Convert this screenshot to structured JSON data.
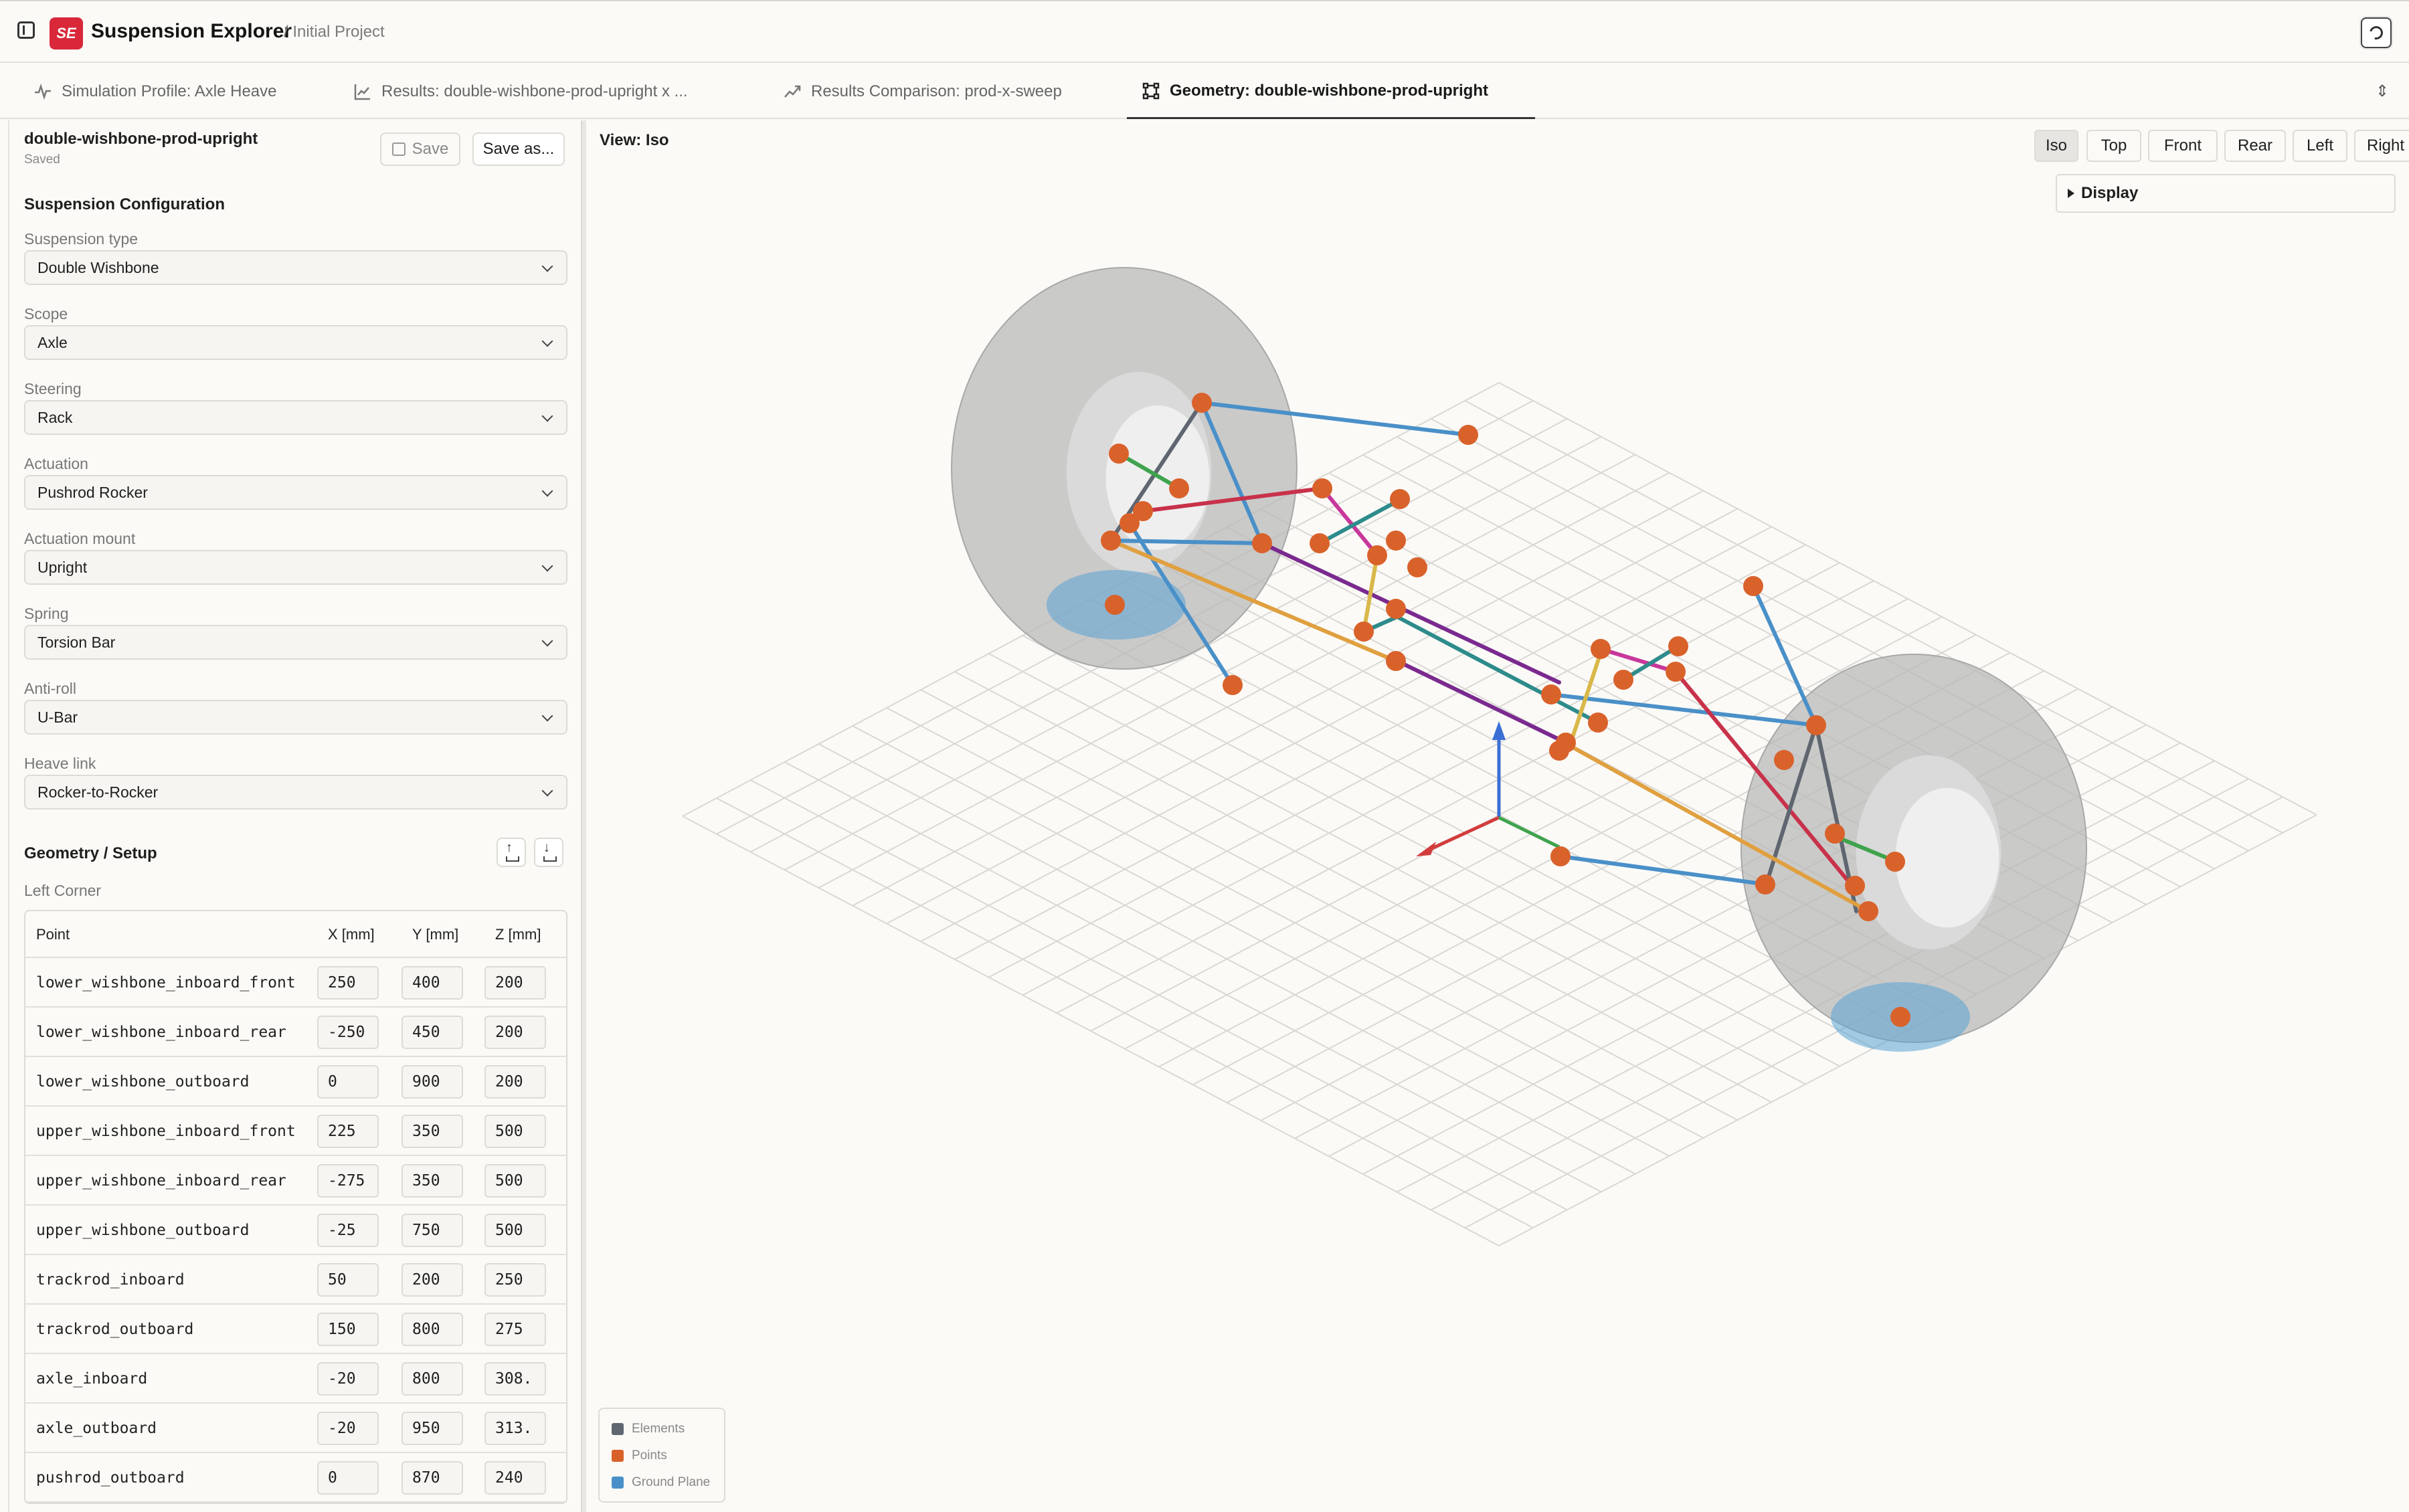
{
  "header": {
    "logo_text": "SE",
    "app_title": "Suspension Explorer",
    "project": "/ Initial Project"
  },
  "tabs": [
    {
      "label": "Simulation Profile: Axle Heave",
      "icon": "pulse-icon"
    },
    {
      "label": "Results: double-wishbone-prod-upright x ...",
      "icon": "line-chart-icon"
    },
    {
      "label": "Results Comparison: prod-x-sweep",
      "icon": "trend-compare-icon"
    },
    {
      "label": "Geometry: double-wishbone-prod-upright",
      "icon": "geometry-nodes-icon"
    }
  ],
  "document": {
    "name": "double-wishbone-prod-upright",
    "status": "Saved",
    "save_label": "Save",
    "save_as_label": "Save as..."
  },
  "config": {
    "title": "Suspension Configuration",
    "fields": [
      {
        "label": "Suspension type",
        "value": "Double Wishbone"
      },
      {
        "label": "Scope",
        "value": "Axle"
      },
      {
        "label": "Steering",
        "value": "Rack"
      },
      {
        "label": "Actuation",
        "value": "Pushrod Rocker"
      },
      {
        "label": "Actuation mount",
        "value": "Upright"
      },
      {
        "label": "Spring",
        "value": "Torsion Bar"
      },
      {
        "label": "Anti-roll",
        "value": "U-Bar"
      },
      {
        "label": "Heave link",
        "value": "Rocker-to-Rocker"
      }
    ]
  },
  "geometry": {
    "title": "Geometry / Setup",
    "corner": "Left Corner",
    "columns": [
      "Point",
      "X [mm]",
      "Y [mm]",
      "Z [mm]"
    ],
    "rows": [
      {
        "point": "lower_wishbone_inboard_front",
        "x": "250",
        "y": "400",
        "z": "200"
      },
      {
        "point": "lower_wishbone_inboard_rear",
        "x": "-250",
        "y": "450",
        "z": "200"
      },
      {
        "point": "lower_wishbone_outboard",
        "x": "0",
        "y": "900",
        "z": "200"
      },
      {
        "point": "upper_wishbone_inboard_front",
        "x": "225",
        "y": "350",
        "z": "500"
      },
      {
        "point": "upper_wishbone_inboard_rear",
        "x": "-275",
        "y": "350",
        "z": "500"
      },
      {
        "point": "upper_wishbone_outboard",
        "x": "-25",
        "y": "750",
        "z": "500"
      },
      {
        "point": "trackrod_inboard",
        "x": "50",
        "y": "200",
        "z": "250"
      },
      {
        "point": "trackrod_outboard",
        "x": "150",
        "y": "800",
        "z": "275"
      },
      {
        "point": "axle_inboard",
        "x": "-20",
        "y": "800",
        "z": "308."
      },
      {
        "point": "axle_outboard",
        "x": "-20",
        "y": "950",
        "z": "313."
      },
      {
        "point": "pushrod_outboard",
        "x": "0",
        "y": "870",
        "z": "240"
      }
    ]
  },
  "viewport": {
    "label": "View: Iso",
    "views": [
      "Iso",
      "Top",
      "Front",
      "Rear",
      "Left",
      "Right"
    ],
    "active_view": "Iso",
    "display_label": "Display",
    "legend": [
      {
        "label": "Elements",
        "color": "#5f6670"
      },
      {
        "label": "Points",
        "color": "#d9622b"
      },
      {
        "label": "Ground Plane",
        "color": "#4a90c8"
      }
    ]
  },
  "colors": {
    "accent": "#d8283a",
    "point": "#d9622b",
    "element": "#5f6670",
    "ground": "#4a90c8"
  }
}
